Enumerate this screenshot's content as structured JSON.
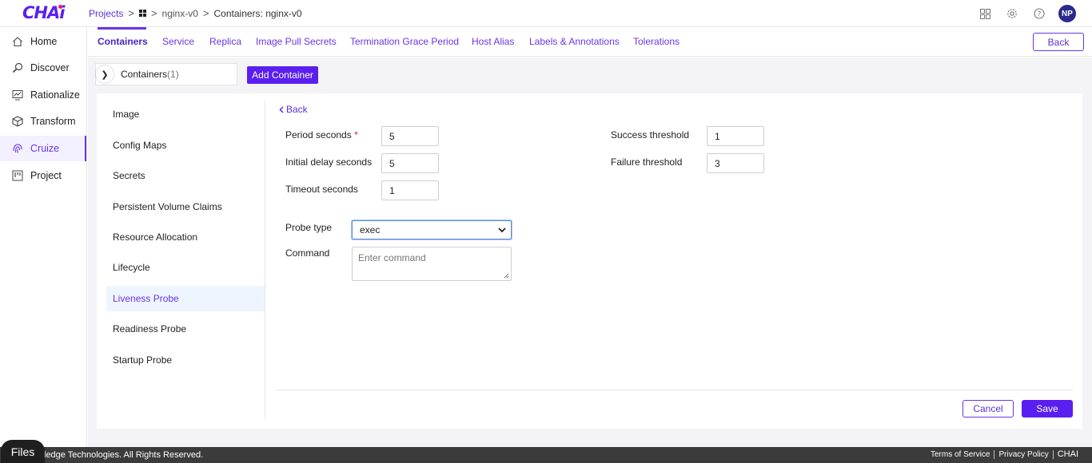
{
  "app": {
    "logo": "CHAi",
    "brand_color": "#5a1ff0"
  },
  "breadcrumb": {
    "projects": "Projects",
    "project": "nginx-v0",
    "current": "Containers: nginx-v0"
  },
  "user": {
    "initials": "NP"
  },
  "sidebar": {
    "items": [
      {
        "label": "Home",
        "icon": "home-icon"
      },
      {
        "label": "Discover",
        "icon": "discover-icon"
      },
      {
        "label": "Rationalize",
        "icon": "rationalize-icon"
      },
      {
        "label": "Transform",
        "icon": "cube-icon"
      },
      {
        "label": "Cruize",
        "icon": "fingerprint-icon"
      },
      {
        "label": "Project",
        "icon": "kanban-icon"
      }
    ],
    "active": "Cruize"
  },
  "tabs": {
    "items": [
      "Containers",
      "Service",
      "Replica",
      "Image Pull Secrets",
      "Termination Grace Period",
      "Host Alias",
      "Labels & Annotations",
      "Tolerations"
    ],
    "active": "Containers",
    "back_label": "Back"
  },
  "containers": {
    "label": "Containers",
    "count": "(1)",
    "add_label": "Add Container"
  },
  "leftnav": {
    "items": [
      "Image",
      "Config Maps",
      "Secrets",
      "Persistent Volume Claims",
      "Resource Allocation",
      "Lifecycle",
      "Liveness Probe",
      "Readiness Probe",
      "Startup Probe"
    ],
    "active": "Liveness Probe"
  },
  "form": {
    "back_label": "Back",
    "period_seconds": {
      "label": "Period seconds",
      "required": "*",
      "value": "5"
    },
    "initial_delay": {
      "label": "Initial delay seconds",
      "value": "5"
    },
    "timeout": {
      "label": "Timeout seconds",
      "value": "1"
    },
    "success_threshold": {
      "label": "Success threshold",
      "value": "1"
    },
    "failure_threshold": {
      "label": "Failure threshold",
      "value": "3"
    },
    "probe_type": {
      "label": "Probe type",
      "value": "exec"
    },
    "command": {
      "label": "Command",
      "placeholder": "Enter command"
    },
    "cancel_label": "Cancel",
    "save_label": "Save"
  },
  "footer": {
    "copyright": "ledge Technologies. All Rights Reserved.",
    "terms": "Terms of Service",
    "privacy": "Privacy Policy",
    "brand": "CHAI",
    "files_chip": "Files"
  }
}
